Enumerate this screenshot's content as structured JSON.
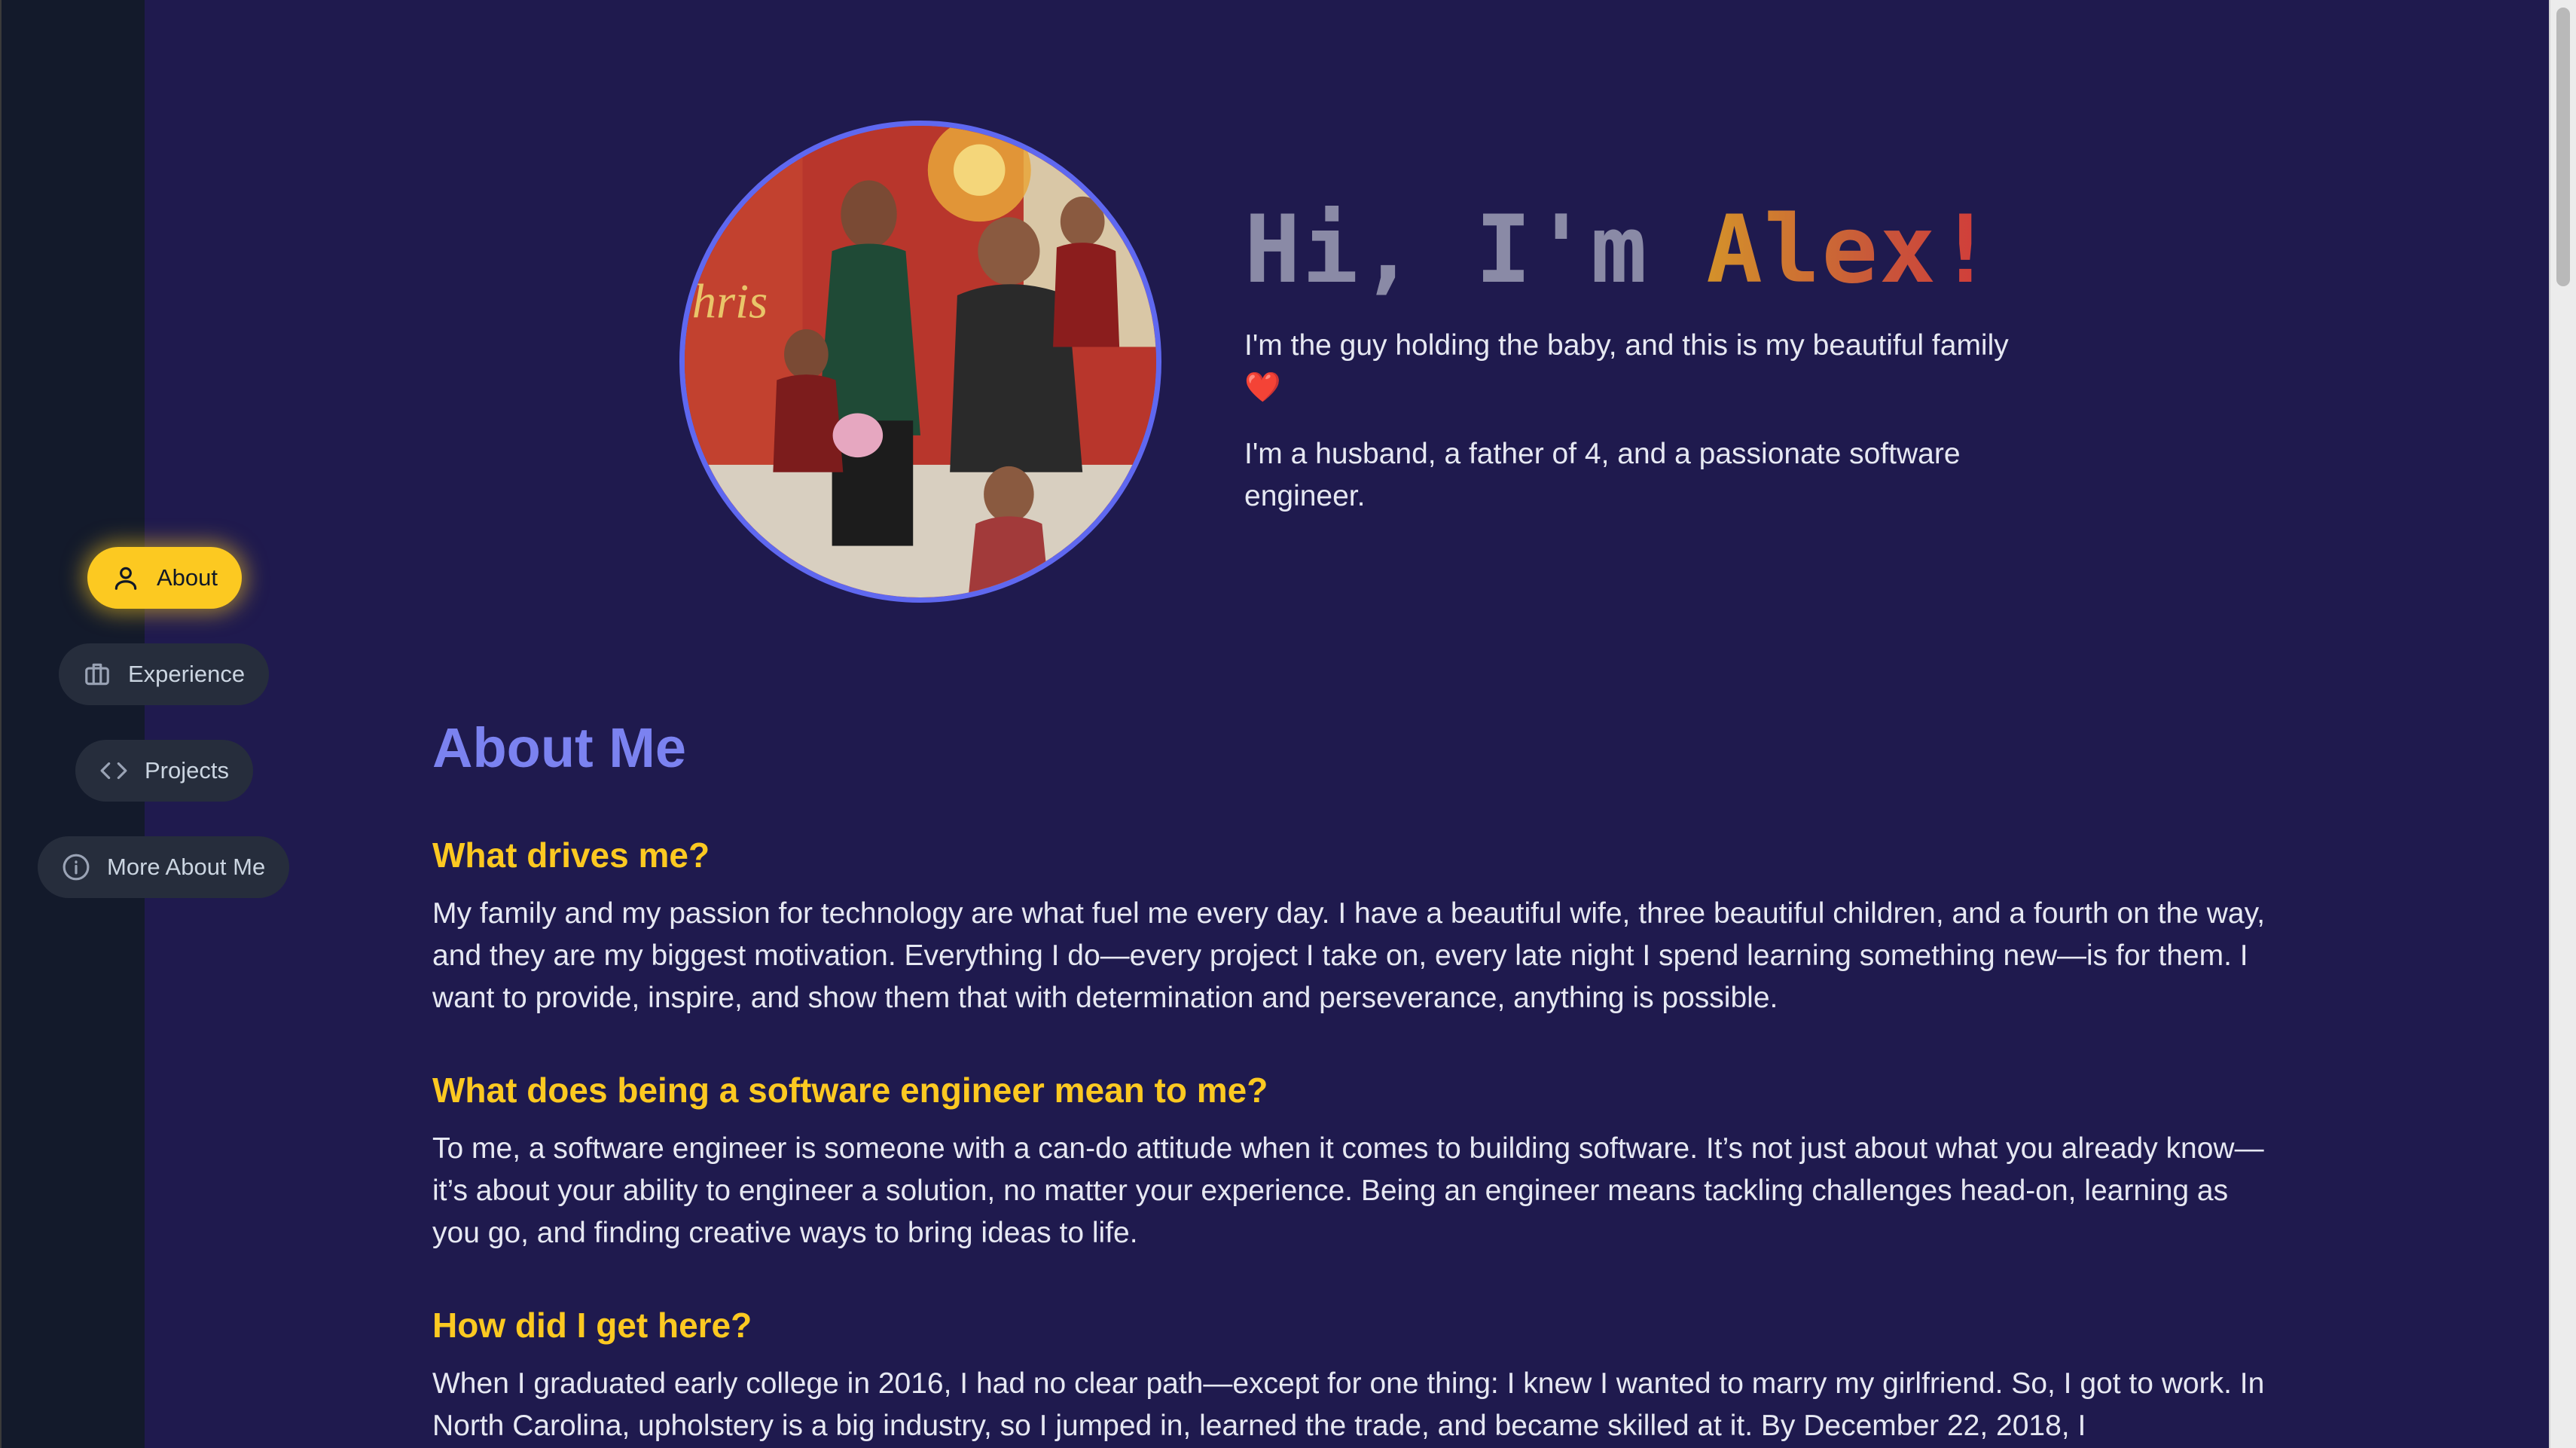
{
  "nav": {
    "items": [
      {
        "label": "About",
        "icon": "user-icon",
        "active": true
      },
      {
        "label": "Experience",
        "icon": "briefcase-icon",
        "active": false
      },
      {
        "label": "Projects",
        "icon": "code-icon",
        "active": false
      },
      {
        "label": "More About Me",
        "icon": "info-icon",
        "active": false
      }
    ]
  },
  "hero": {
    "greeting": "Hi, I'm ",
    "name": "Alex!",
    "line1": "I'm the guy holding the baby, and this is my beautiful family ❤️",
    "line2": "I'm a husband, a father of 4, and a passionate software engineer."
  },
  "about": {
    "title": "About Me",
    "sections": [
      {
        "heading": "What drives me?",
        "body": "My family and my passion for technology are what fuel me every day. I have a beautiful wife, three beautiful children, and a fourth on the way, and they are my biggest motivation. Everything I do—every project I take on, every late night I spend learning something new—is for them. I want to provide, inspire, and show them that with determination and perseverance, anything is possible."
      },
      {
        "heading": "What does being a software engineer mean to me?",
        "body": "To me, a software engineer is someone with a can-do attitude when it comes to building software. It’s not just about what you already know—it’s about your ability to engineer a solution, no matter your experience. Being an engineer means tackling challenges head-on, learning as you go, and finding creative ways to bring ideas to life."
      },
      {
        "heading": "How did I get here?",
        "body": "When I graduated early college in 2016, I had no clear path—except for one thing: I knew I wanted to marry my girlfriend. So, I got to work. In North Carolina, upholstery is a big industry, so I jumped in, learned the trade, and became skilled at it. By December 22, 2018, I"
      }
    ]
  },
  "colors": {
    "accent": "#fcc921",
    "heading": "#7b82f0",
    "background": "#1f1a4e",
    "sidebar": "#131a2b"
  }
}
